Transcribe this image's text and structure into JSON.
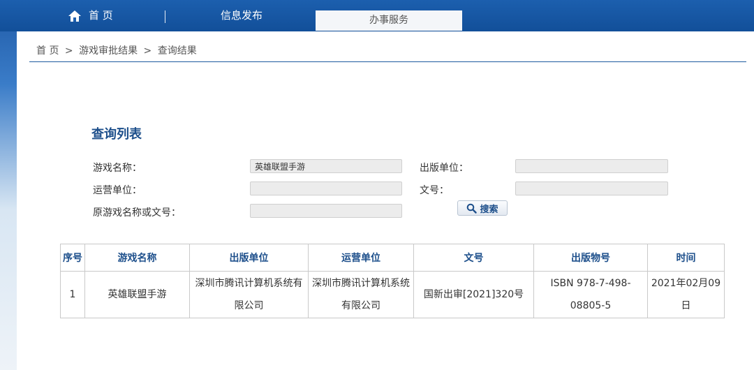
{
  "nav": {
    "home": "首 页",
    "info": "信息发布",
    "service": "办事服务"
  },
  "breadcrumb": {
    "home": "首 页",
    "sep1": ">",
    "level2": "游戏审批结果",
    "sep2": ">",
    "current": "查询结果"
  },
  "section_title": "查询列表",
  "form": {
    "game_name_label": "游戏名称：",
    "game_name_value": "英雄联盟手游",
    "publisher_label": "出版单位：",
    "publisher_value": "",
    "operator_label": "运营单位：",
    "operator_value": "",
    "doc_no_label": "文号：",
    "doc_no_value": "",
    "original_label": "原游戏名称或文号：",
    "original_value": "",
    "search_label": "搜索"
  },
  "table": {
    "headers": [
      "序号",
      "游戏名称",
      "出版单位",
      "运营单位",
      "文号",
      "出版物号",
      "时间"
    ],
    "rows": [
      {
        "no": "1",
        "game": "英雄联盟手游",
        "publisher": "深圳市腾讯计算机系统有限公司",
        "operator": "深圳市腾讯计算机系统有限公司",
        "doc_no": "国新出审[2021]320号",
        "isbn": "ISBN 978-7-498-08805-5",
        "date": "2021年02月09日"
      }
    ]
  },
  "colors": {
    "nav_blue": "#1c5fae",
    "title_blue": "#1d4f8b"
  }
}
